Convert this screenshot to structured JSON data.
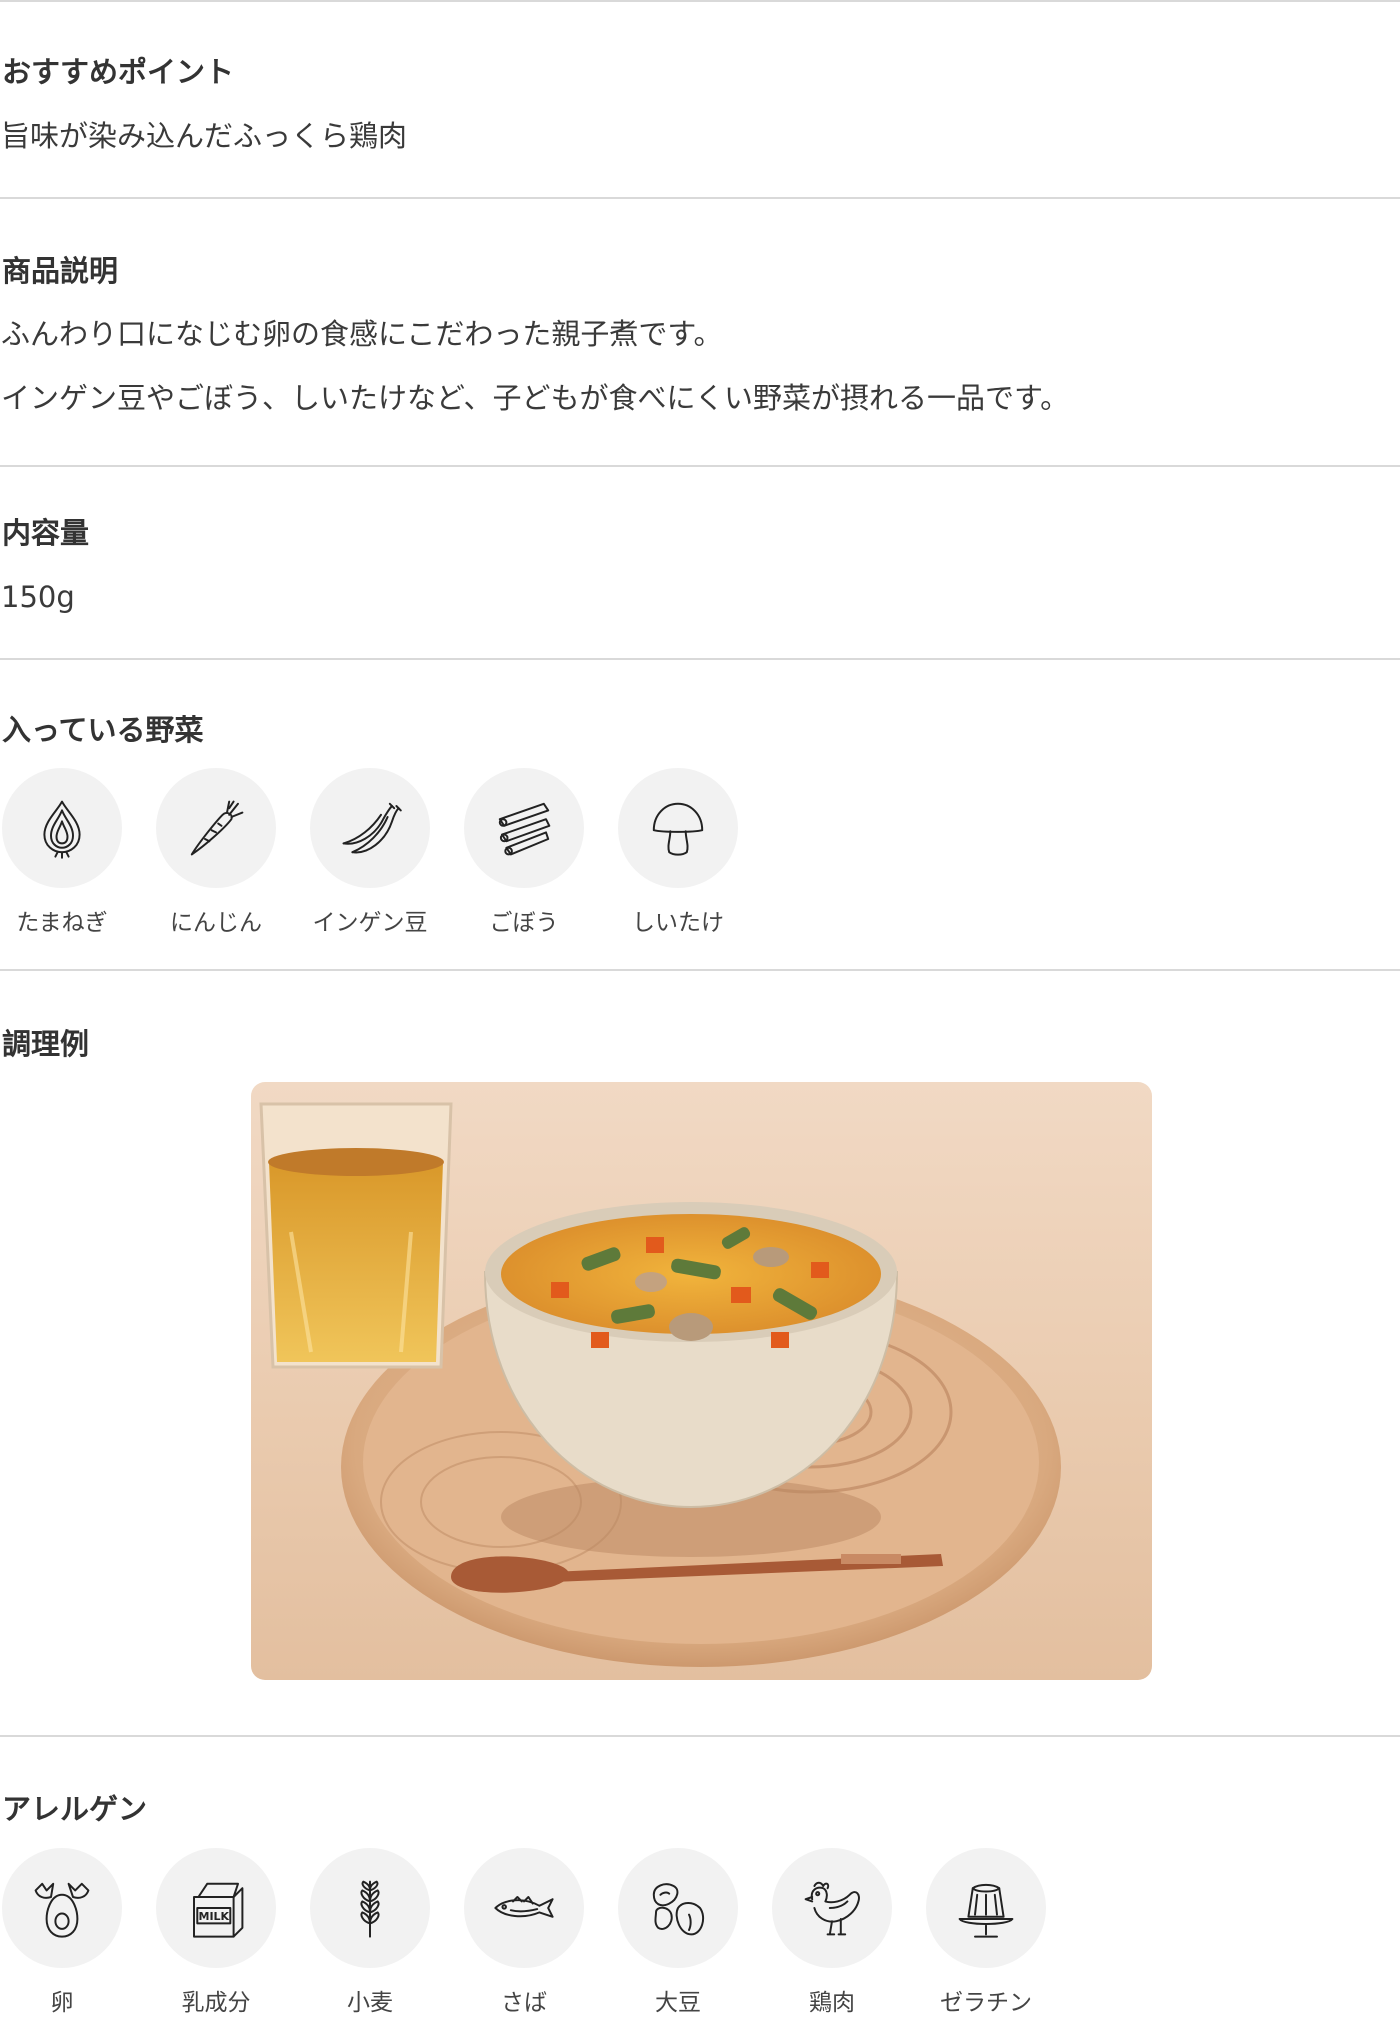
{
  "sections": {
    "recommend": {
      "title": "おすすめポイント",
      "text": "旨味が染み込んだふっくら鶏肉"
    },
    "description": {
      "title": "商品説明",
      "lines": [
        "ふんわり口になじむ卵の食感にこだわった親子煮です。",
        "インゲン豆やごぼう、しいたけなど、子どもが食べにくい野菜が摂れる一品です。"
      ]
    },
    "content": {
      "title": "内容量",
      "value": "150g"
    },
    "vegetables": {
      "title": "入っている野菜",
      "items": [
        {
          "label": "たまねぎ",
          "icon": "onion-icon"
        },
        {
          "label": "にんじん",
          "icon": "carrot-icon"
        },
        {
          "label": "インゲン豆",
          "icon": "green-bean-icon"
        },
        {
          "label": "ごぼう",
          "icon": "burdock-icon"
        },
        {
          "label": "しいたけ",
          "icon": "mushroom-icon"
        }
      ]
    },
    "cooking": {
      "title": "調理例",
      "image": "oyako-ni-bowl-on-wooden-tray-photo"
    },
    "allergens": {
      "title": "アレルゲン",
      "items": [
        {
          "label": "卵",
          "icon": "egg-icon"
        },
        {
          "label": "乳成分",
          "icon": "milk-icon"
        },
        {
          "label": "小麦",
          "icon": "wheat-icon"
        },
        {
          "label": "さば",
          "icon": "fish-icon"
        },
        {
          "label": "大豆",
          "icon": "soybean-icon"
        },
        {
          "label": "鶏肉",
          "icon": "chicken-icon"
        },
        {
          "label": "ゼラチン",
          "icon": "gelatin-icon"
        }
      ]
    }
  },
  "colors": {
    "divider": "#d9d9d9",
    "icon_bg": "#f2f2f2",
    "text": "#333333"
  }
}
